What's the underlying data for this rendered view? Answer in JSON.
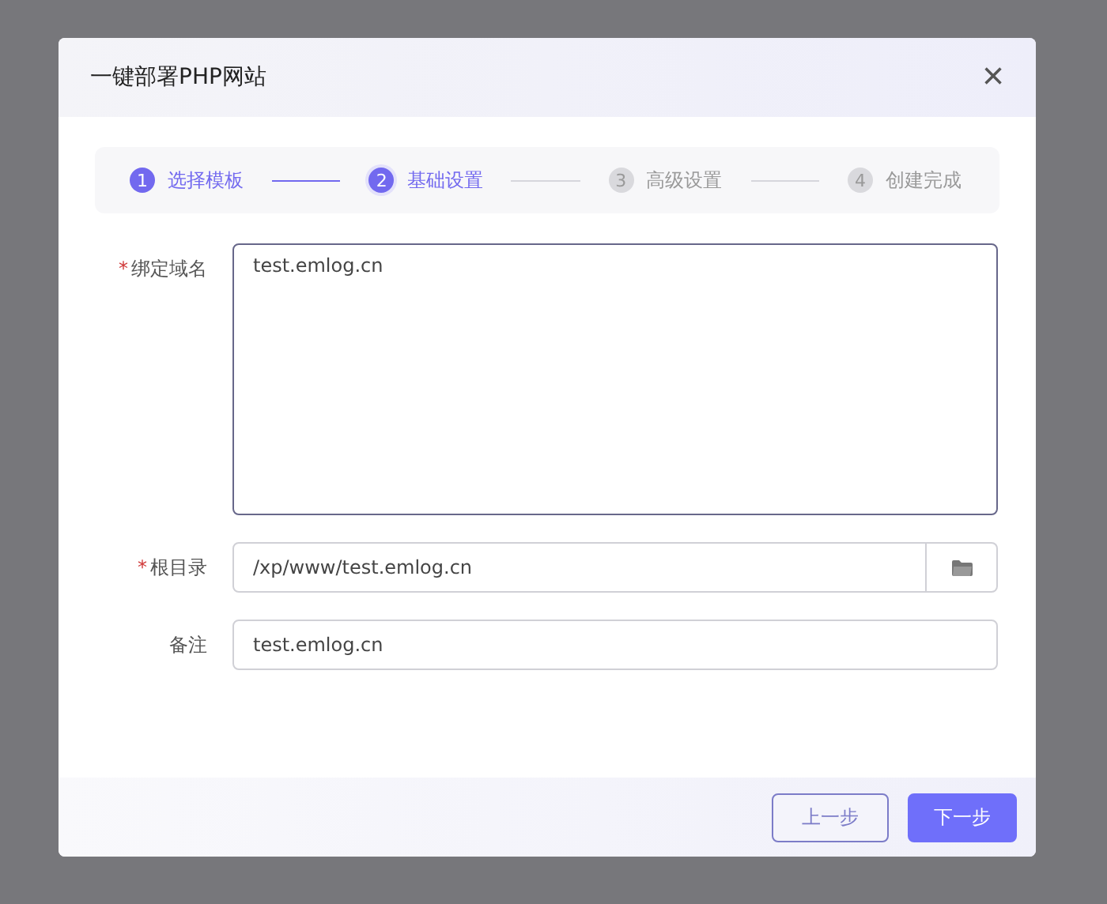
{
  "dialog": {
    "title": "一键部署PHP网站",
    "close_label": "×"
  },
  "steps": [
    {
      "number": "1",
      "label": "选择模板",
      "completed": true,
      "selected": false
    },
    {
      "number": "2",
      "label": "基础设置",
      "completed": false,
      "selected": true
    },
    {
      "number": "3",
      "label": "高级设置",
      "completed": false,
      "selected": false
    },
    {
      "number": "4",
      "label": "创建完成",
      "selected": false
    }
  ],
  "fields": [
    {
      "kind": "textarea",
      "label": "绑定域名",
      "required_mark": "*",
      "focused": true,
      "value": "test.emlog.cn"
    },
    {
      "kind": "path",
      "label": "根目录",
      "required_mark": "*",
      "focused": false,
      "value": "/xp/www/test.emlog.cn"
    },
    {
      "kind": "input",
      "label": "备注",
      "focused": false,
      "value": "test.emlog.cn"
    }
  ],
  "buttons": [
    {
      "label": "上一步",
      "kind": "secondary"
    },
    {
      "label": "下一步",
      "kind": "primary"
    }
  ]
}
